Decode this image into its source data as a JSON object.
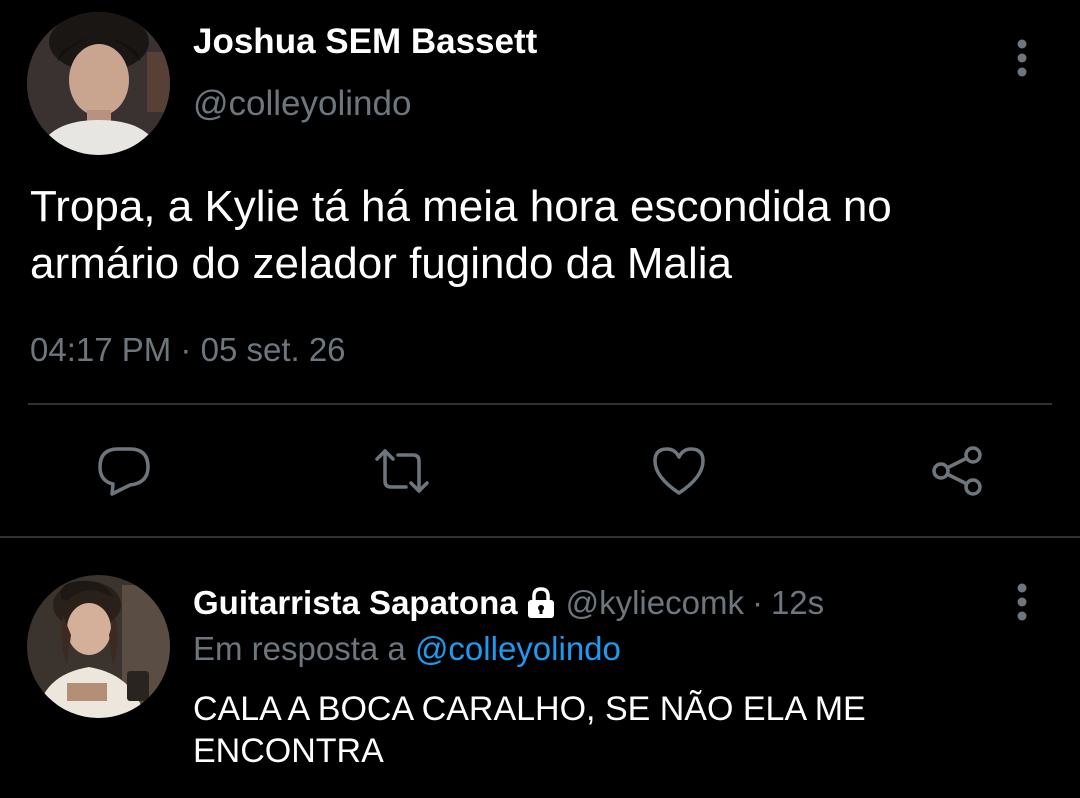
{
  "main_tweet": {
    "author_name": "Joshua SEM Bassett",
    "author_handle": "@colleyolindo",
    "text_line1": "Tropa, a Kylie tá há meia hora escondida no",
    "text_line2": "armário do zelador fugindo da Malia",
    "time": "04:17 PM",
    "date_sep": "·",
    "date": "05 set. 26",
    "more_icon": "more-vertical-icon"
  },
  "actions": [
    {
      "name": "reply",
      "icon": "comment-icon"
    },
    {
      "name": "retweet",
      "icon": "retweet-icon"
    },
    {
      "name": "like",
      "icon": "heart-icon"
    },
    {
      "name": "share",
      "icon": "share-icon"
    }
  ],
  "reply_tweet": {
    "author_name": "Guitarrista Sapatona",
    "author_handle": "@kyliecomk",
    "sep": "·",
    "time": "12s",
    "replying_prefix": "Em resposta a",
    "replying_mention": "@colleyolindo",
    "text_line1": "CALA A BOCA CARALHO, SE NÃO ELA ME",
    "text_line2": "ENCONTRA"
  },
  "colors": {
    "background": "#000000",
    "text_primary": "#ffffff",
    "text_secondary": "#6e767d",
    "accent": "#1d9bf0",
    "divider": "#2f3336"
  }
}
